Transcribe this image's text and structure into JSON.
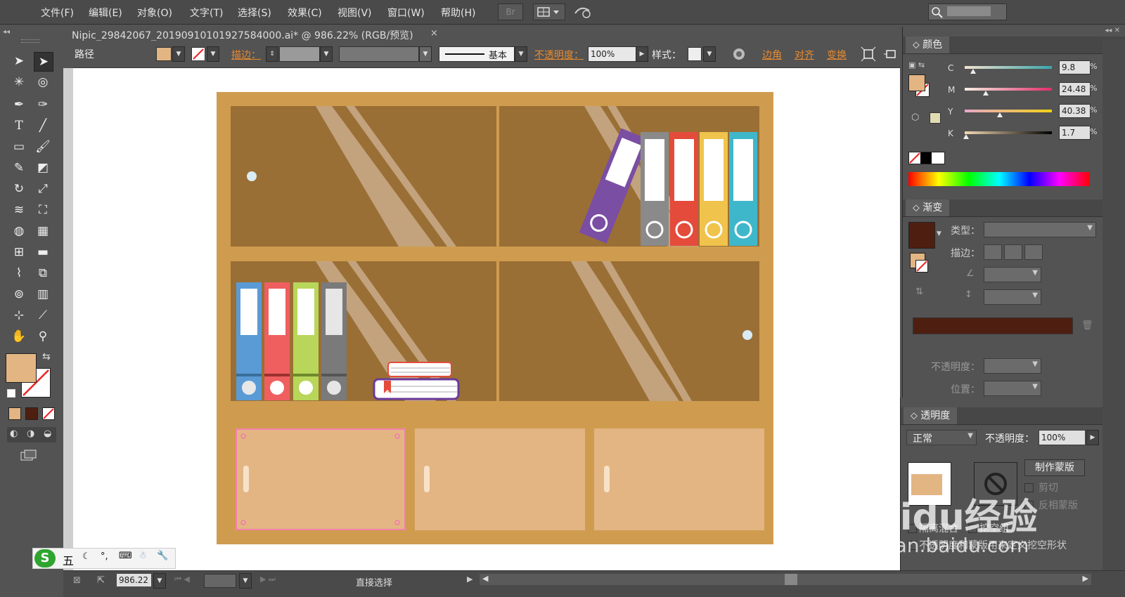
{
  "menu": {
    "items": [
      "文件(F)",
      "编辑(E)",
      "对象(O)",
      "文字(T)",
      "选择(S)",
      "效果(C)",
      "视图(V)",
      "窗口(W)",
      "帮助(H)"
    ],
    "br_label": "Br"
  },
  "document": {
    "tab_title": "Nipic_29842067_20190910101927584000.ai* @ 986.22% (RGB/预览)",
    "close": "×"
  },
  "control_bar": {
    "object_type": "路径",
    "stroke_label": "描边：",
    "stroke_style": "基本",
    "opacity_label": "不透明度：",
    "opacity_value": "100%",
    "style_label": "样式：",
    "corner_label": "边角",
    "align_label": "对齐",
    "transform_label": "变换"
  },
  "colors": {
    "fill": "#e3b583",
    "cabinet_frame": "#cf9c4f",
    "cabinet_back": "#9a6f35",
    "drawer": "#e3b583",
    "selection": "#ff5cc8",
    "gradient_stop": "#4e1f10",
    "accent_orange": "#e88a2e"
  },
  "color_panel": {
    "title": "颜色",
    "channels": [
      {
        "label": "C",
        "value": "9.8",
        "fraction": 0.098,
        "gradient": "linear-gradient(90deg,#f2e2cf,#3aa7ad)"
      },
      {
        "label": "M",
        "value": "24.48",
        "fraction": 0.245,
        "gradient": "linear-gradient(90deg,#f5efe2,#e12d6b)"
      },
      {
        "label": "Y",
        "value": "40.38",
        "fraction": 0.404,
        "gradient": "linear-gradient(90deg,#e9a8c8,#f3d214)"
      },
      {
        "label": "K",
        "value": "1.7",
        "fraction": 0.017,
        "gradient": "linear-gradient(90deg,#f6d9b3,#000)"
      }
    ],
    "unit": "%"
  },
  "gradient_panel": {
    "title": "渐变",
    "type_label": "类型：",
    "stroke_label": "描边：",
    "opacity_label": "不透明度：",
    "position_label": "位置："
  },
  "transparency_panel": {
    "title": "透明度",
    "blend_mode": "正常",
    "opacity_label": "不透明度：",
    "opacity_value": "100%",
    "make_mask": "制作蒙版",
    "clip": "剪切",
    "invert_mask": "反相蒙版",
    "isolate_blend": "隔离混合",
    "knockout_group": "挖空组",
    "opacity_mask_shape": "不透明度和蒙版用来定义挖空形状"
  },
  "status_bar": {
    "zoom": "986.22",
    "tool_name": "直接选择"
  },
  "ime": {
    "mode": "五"
  },
  "watermark": {
    "line1": "Baidu经验",
    "line2": "jingyan.baidu.com"
  }
}
